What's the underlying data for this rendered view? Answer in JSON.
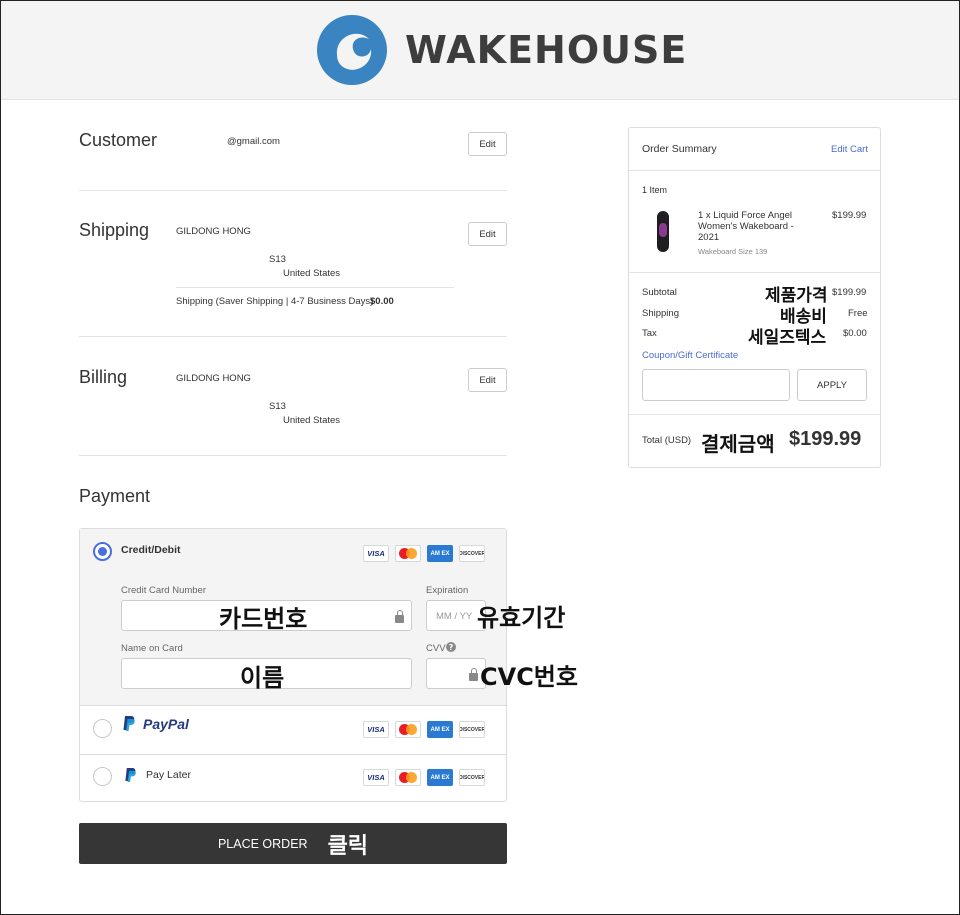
{
  "brand": {
    "name": "WAKEHOUSE"
  },
  "customer": {
    "title": "Customer",
    "email": "@gmail.com",
    "edit_label": "Edit"
  },
  "shipping": {
    "title": "Shipping",
    "name": "GILDONG HONG",
    "address_line": "S13",
    "country": "United States",
    "method": "Shipping (Saver Shipping | 4-7 Business Days)",
    "method_price": "$0.00",
    "edit_label": "Edit"
  },
  "billing": {
    "title": "Billing",
    "name": "GILDONG HONG",
    "address_line": "S13",
    "country": "United States",
    "edit_label": "Edit"
  },
  "payment": {
    "title": "Payment",
    "credit_label": "Credit/Debit",
    "card_number_label": "Credit Card Number",
    "expiration_label": "Expiration",
    "expiration_placeholder": "MM / YY",
    "name_label": "Name on Card",
    "cvv_label": "CVV",
    "paypal_label": "PayPal",
    "paylater_label": "Pay Later",
    "card_icons": [
      "visa-icon",
      "mastercard-icon",
      "amex-icon",
      "discover-icon"
    ],
    "card_texts": {
      "visa": "VISA",
      "amex": "AM EX",
      "discover": "DISCOVER"
    }
  },
  "place_order_label": "PLACE ORDER",
  "summary": {
    "title": "Order Summary",
    "edit_cart": "Edit Cart",
    "item_count": "1 Item",
    "item_name": "1 x Liquid Force Angel Women's Wakeboard - 2021",
    "item_option": "Wakeboard Size 139",
    "item_price": "$199.99",
    "subtotal_label": "Subtotal",
    "subtotal_value": "$199.99",
    "shipping_label": "Shipping",
    "shipping_value": "Free",
    "tax_label": "Tax",
    "tax_value": "$0.00",
    "coupon_label": "Coupon/Gift Certificate",
    "apply_label": "APPLY",
    "total_label": "Total (USD)",
    "total_value": "$199.99"
  },
  "annotations": {
    "card_number": "카드번호",
    "expiration": "유효기간",
    "name": "이름",
    "cvc": "CVC번호",
    "click": "클릭",
    "product_price": "제품가격",
    "shipping_fee": "배송비",
    "sales_tax": "세일즈텍스",
    "total": "결제금액"
  },
  "colors": {
    "accent": "#4a6ee0",
    "logo_blue": "#3a84c2",
    "button_dark": "#363636"
  }
}
